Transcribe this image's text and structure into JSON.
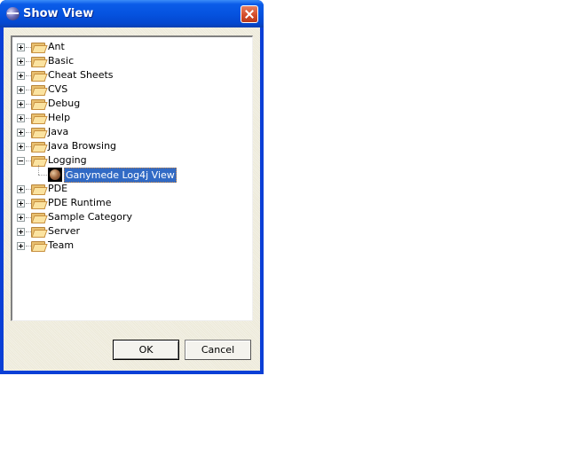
{
  "window": {
    "title": "Show View",
    "icon": "eclipse-icon",
    "close_icon": "close-icon"
  },
  "tree": {
    "items": [
      {
        "label": "Ant",
        "expanded": false
      },
      {
        "label": "Basic",
        "expanded": false
      },
      {
        "label": "Cheat Sheets",
        "expanded": false
      },
      {
        "label": "CVS",
        "expanded": false
      },
      {
        "label": "Debug",
        "expanded": false
      },
      {
        "label": "Help",
        "expanded": false
      },
      {
        "label": "Java",
        "expanded": false
      },
      {
        "label": "Java Browsing",
        "expanded": false
      },
      {
        "label": "Logging",
        "expanded": true,
        "children": [
          {
            "label": "Ganymede Log4j View",
            "selected": true
          }
        ]
      },
      {
        "label": "PDE",
        "expanded": false
      },
      {
        "label": "PDE Runtime",
        "expanded": false
      },
      {
        "label": "Sample Category",
        "expanded": false
      },
      {
        "label": "Server",
        "expanded": false
      },
      {
        "label": "Team",
        "expanded": false
      }
    ]
  },
  "buttons": {
    "ok": "OK",
    "cancel": "Cancel"
  },
  "colors": {
    "titlebar": "#0553e0",
    "selection": "#316ac5",
    "dialog_bg": "#ece9d8"
  }
}
